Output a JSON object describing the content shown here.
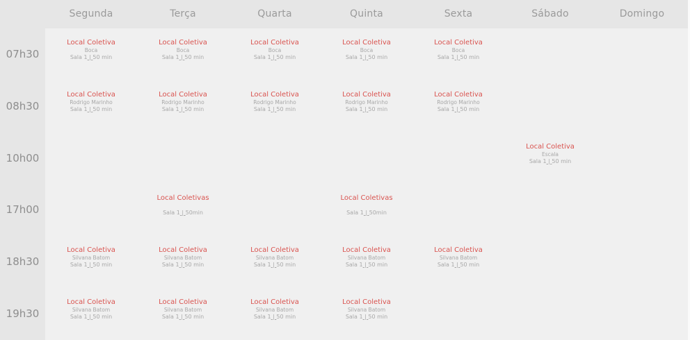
{
  "days": [
    "Segunda",
    "Terça",
    "Quarta",
    "Quinta",
    "Sexta",
    "Sábado",
    "Domingo"
  ],
  "times": [
    "07h30",
    "08h30",
    "10h00",
    "17h00",
    "18h30",
    "19h30"
  ],
  "events": [
    {
      "day": 0,
      "slot": 0,
      "title": "Local Coletiva",
      "instructor": "Boca",
      "room": "Sala 1",
      "duration": "50 min"
    },
    {
      "day": 1,
      "slot": 0,
      "title": "Local Coletiva",
      "instructor": "Boca",
      "room": "Sala 1",
      "duration": "50 min"
    },
    {
      "day": 2,
      "slot": 0,
      "title": "Local Coletiva",
      "instructor": "Boca",
      "room": "Sala 1",
      "duration": "50 min"
    },
    {
      "day": 3,
      "slot": 0,
      "title": "Local Coletiva",
      "instructor": "Boca",
      "room": "Sala 1",
      "duration": "50 min"
    },
    {
      "day": 4,
      "slot": 0,
      "title": "Local Coletiva",
      "instructor": "Boca",
      "room": "Sala 1",
      "duration": "50 min"
    },
    {
      "day": 0,
      "slot": 1,
      "title": "Local Coletiva",
      "instructor": "Rodrigo Marinho",
      "room": "Sala 1",
      "duration": "50 min"
    },
    {
      "day": 1,
      "slot": 1,
      "title": "Local Coletiva",
      "instructor": "Rodrigo Marinho",
      "room": "Sala 1",
      "duration": "50 min"
    },
    {
      "day": 2,
      "slot": 1,
      "title": "Local Coletiva",
      "instructor": "Rodrigo Marinho",
      "room": "Sala 1",
      "duration": "50 min"
    },
    {
      "day": 3,
      "slot": 1,
      "title": "Local Coletiva",
      "instructor": "Rodrigo Marinho",
      "room": "Sala 1",
      "duration": "50 min"
    },
    {
      "day": 4,
      "slot": 1,
      "title": "Local Coletiva",
      "instructor": "Rodrigo Marinho",
      "room": "Sala 1",
      "duration": "50 min"
    },
    {
      "day": 5,
      "slot": 2,
      "title": "Local Coletiva",
      "instructor": "Escala",
      "room": "Sala 1",
      "duration": "50 min"
    },
    {
      "day": 1,
      "slot": 3,
      "title": "Local Coletivas",
      "instructor": "",
      "room": "Sala 1",
      "duration": "50min"
    },
    {
      "day": 3,
      "slot": 3,
      "title": "Local Coletivas",
      "instructor": "",
      "room": "Sala 1",
      "duration": "50min"
    },
    {
      "day": 0,
      "slot": 4,
      "title": "Local Coletiva",
      "instructor": "Silvana Batom",
      "room": "Sala 1",
      "duration": "50 min"
    },
    {
      "day": 1,
      "slot": 4,
      "title": "Local Coletiva",
      "instructor": "Silvana Batom",
      "room": "Sala 1",
      "duration": "50 min"
    },
    {
      "day": 2,
      "slot": 4,
      "title": "Local Coletiva",
      "instructor": "Silvana Batom",
      "room": "Sala 1",
      "duration": "50 min"
    },
    {
      "day": 3,
      "slot": 4,
      "title": "Local Coletiva",
      "instructor": "Silvana Batom",
      "room": "Sala 1",
      "duration": "50 min"
    },
    {
      "day": 4,
      "slot": 4,
      "title": "Local Coletiva",
      "instructor": "Silvana Batom",
      "room": "Sala 1",
      "duration": "50 min"
    },
    {
      "day": 0,
      "slot": 5,
      "title": "Local Coletiva",
      "instructor": "Silvana Batom",
      "room": "Sala 1",
      "duration": "50 min"
    },
    {
      "day": 1,
      "slot": 5,
      "title": "Local Coletiva",
      "instructor": "Silvana Batom",
      "room": "Sala 1",
      "duration": "50 min"
    },
    {
      "day": 2,
      "slot": 5,
      "title": "Local Coletiva",
      "instructor": "Silvana Batom",
      "room": "Sala 1",
      "duration": "50 min"
    },
    {
      "day": 3,
      "slot": 5,
      "title": "Local Coletiva",
      "instructor": "Silvana Batom",
      "room": "Sala 1",
      "duration": "50 min"
    }
  ],
  "colors": {
    "title": "#d9534f",
    "muted": "#a8a8a8",
    "header_text": "#9a9a9a",
    "time_text": "#8e8e8e",
    "grid_bg": "#f0f0f0",
    "page_bg": "#e6e6e6"
  }
}
